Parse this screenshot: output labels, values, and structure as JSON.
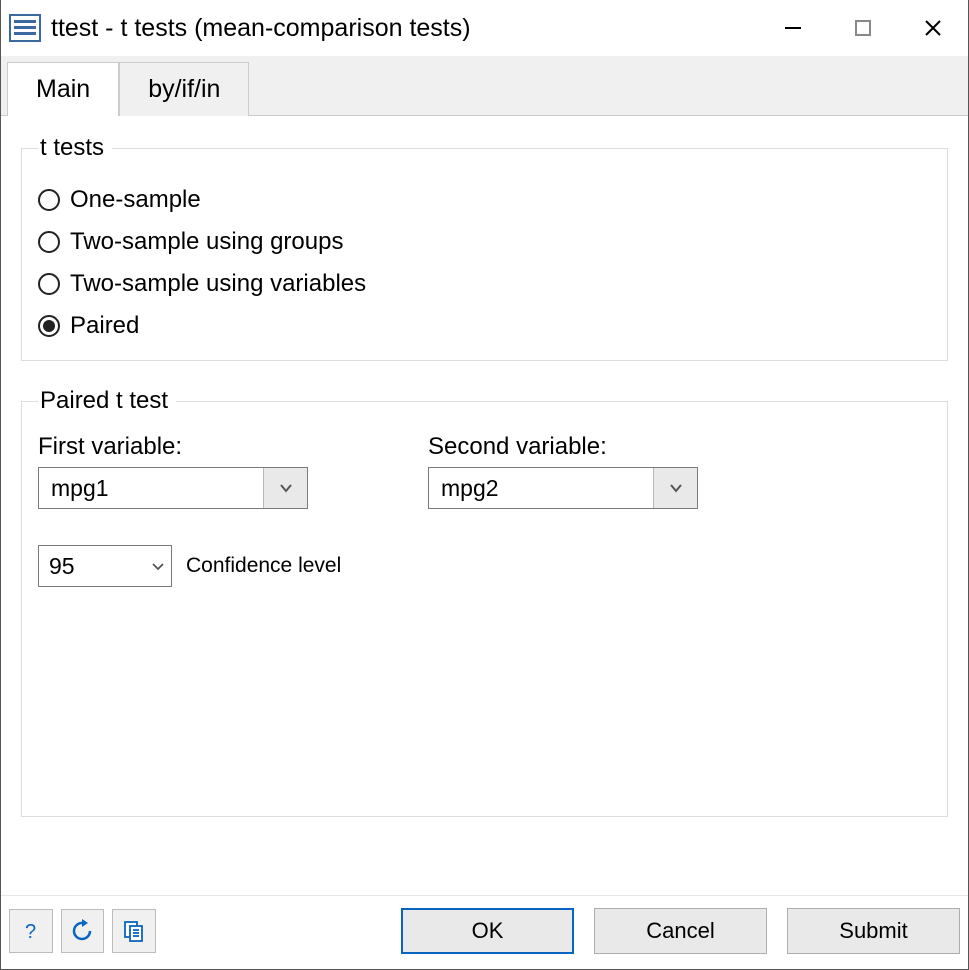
{
  "window": {
    "title": "ttest - t tests (mean-comparison tests)"
  },
  "tabs": {
    "main": "Main",
    "byifin": "by/if/in"
  },
  "group_ttests": {
    "legend": "t tests",
    "options": {
      "one_sample": "One-sample",
      "two_sample_groups": "Two-sample using groups",
      "two_sample_vars": "Two-sample using variables",
      "paired": "Paired"
    },
    "selected": "paired"
  },
  "group_paired": {
    "legend": "Paired t test",
    "first_label": "First variable:",
    "second_label": "Second variable:",
    "first_value": "mpg1",
    "second_value": "mpg2",
    "conf_value": "95",
    "conf_label": "Confidence level"
  },
  "buttons": {
    "ok": "OK",
    "cancel": "Cancel",
    "submit": "Submit"
  }
}
